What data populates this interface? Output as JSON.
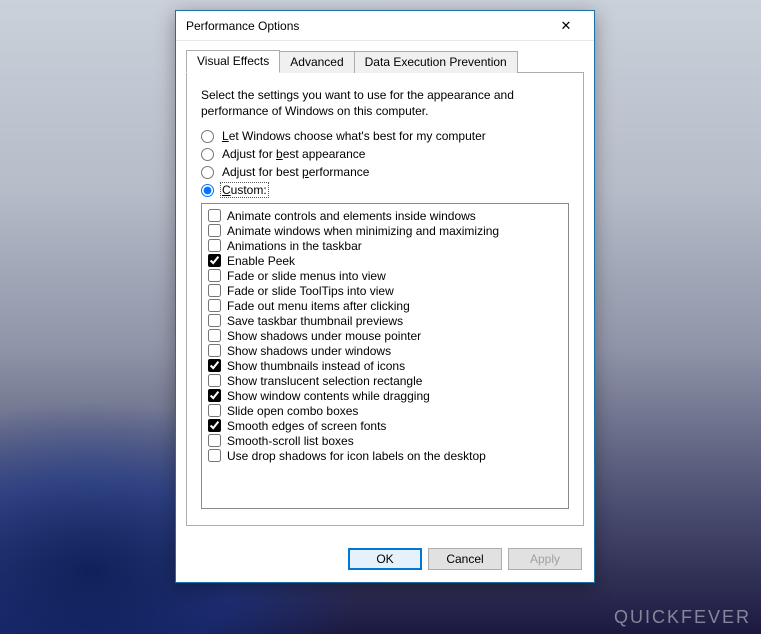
{
  "watermark": "QUICKFEVER",
  "dialog": {
    "title": "Performance Options",
    "tabs": [
      {
        "label": "Visual Effects",
        "active": true
      },
      {
        "label": "Advanced",
        "active": false
      },
      {
        "label": "Data Execution Prevention",
        "active": false
      }
    ],
    "intro": "Select the settings you want to use for the appearance and performance of Windows on this computer.",
    "radios": [
      {
        "id": "let-windows",
        "label": "Let Windows choose what's best for my computer",
        "checked": false,
        "underline": "L"
      },
      {
        "id": "best-appearance",
        "label": "Adjust for best appearance",
        "checked": false,
        "underline": "b"
      },
      {
        "id": "best-performance",
        "label": "Adjust for best performance",
        "checked": false,
        "underline": "p"
      },
      {
        "id": "custom",
        "label": "Custom:",
        "checked": true,
        "underline": "C"
      }
    ],
    "checks": [
      {
        "label": "Animate controls and elements inside windows",
        "checked": false
      },
      {
        "label": "Animate windows when minimizing and maximizing",
        "checked": false
      },
      {
        "label": "Animations in the taskbar",
        "checked": false
      },
      {
        "label": "Enable Peek",
        "checked": true
      },
      {
        "label": "Fade or slide menus into view",
        "checked": false
      },
      {
        "label": "Fade or slide ToolTips into view",
        "checked": false
      },
      {
        "label": "Fade out menu items after clicking",
        "checked": false
      },
      {
        "label": "Save taskbar thumbnail previews",
        "checked": false
      },
      {
        "label": "Show shadows under mouse pointer",
        "checked": false
      },
      {
        "label": "Show shadows under windows",
        "checked": false
      },
      {
        "label": "Show thumbnails instead of icons",
        "checked": true
      },
      {
        "label": "Show translucent selection rectangle",
        "checked": false
      },
      {
        "label": "Show window contents while dragging",
        "checked": true
      },
      {
        "label": "Slide open combo boxes",
        "checked": false
      },
      {
        "label": "Smooth edges of screen fonts",
        "checked": true
      },
      {
        "label": "Smooth-scroll list boxes",
        "checked": false
      },
      {
        "label": "Use drop shadows for icon labels on the desktop",
        "checked": false
      }
    ],
    "buttons": {
      "ok": "OK",
      "cancel": "Cancel",
      "apply": "Apply"
    }
  }
}
